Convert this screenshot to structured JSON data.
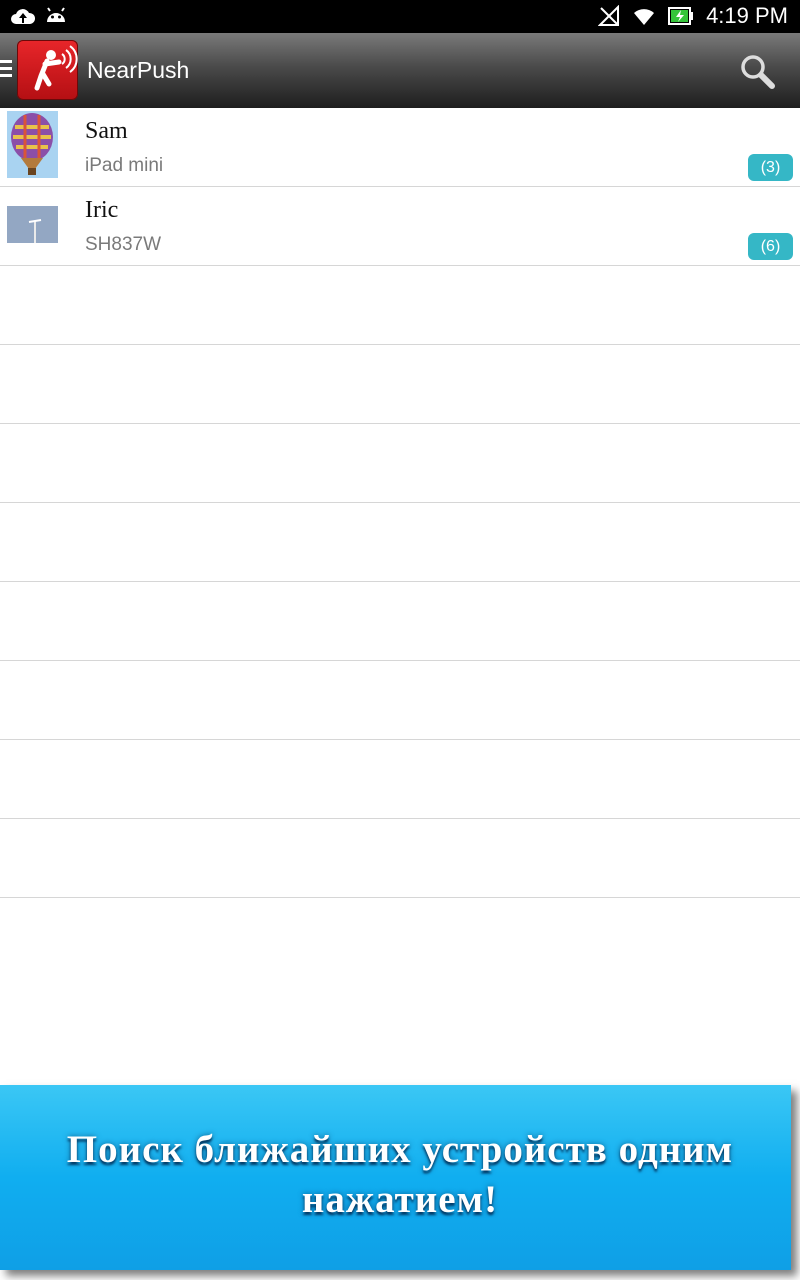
{
  "status_bar": {
    "time": "4:19 PM",
    "icons": [
      "cloud-upload-icon",
      "android-icon",
      "no-signal-icon",
      "wifi-icon",
      "battery-charging-icon"
    ]
  },
  "action_bar": {
    "title": "NearPush",
    "icons": [
      "menu-icon",
      "app-logo-icon",
      "search-icon"
    ]
  },
  "devices": [
    {
      "name": "Sam",
      "model": "iPad mini",
      "count": "(3)"
    },
    {
      "name": "Iric",
      "model": "SH837W",
      "count": "(6)"
    }
  ],
  "promo": {
    "line1": "Поиск ближайших устройств одним",
    "line2": "нажатием!"
  },
  "colors": {
    "badge": "#35b7c6",
    "banner": "#10aef0",
    "app_icon": "#d41a1e"
  }
}
